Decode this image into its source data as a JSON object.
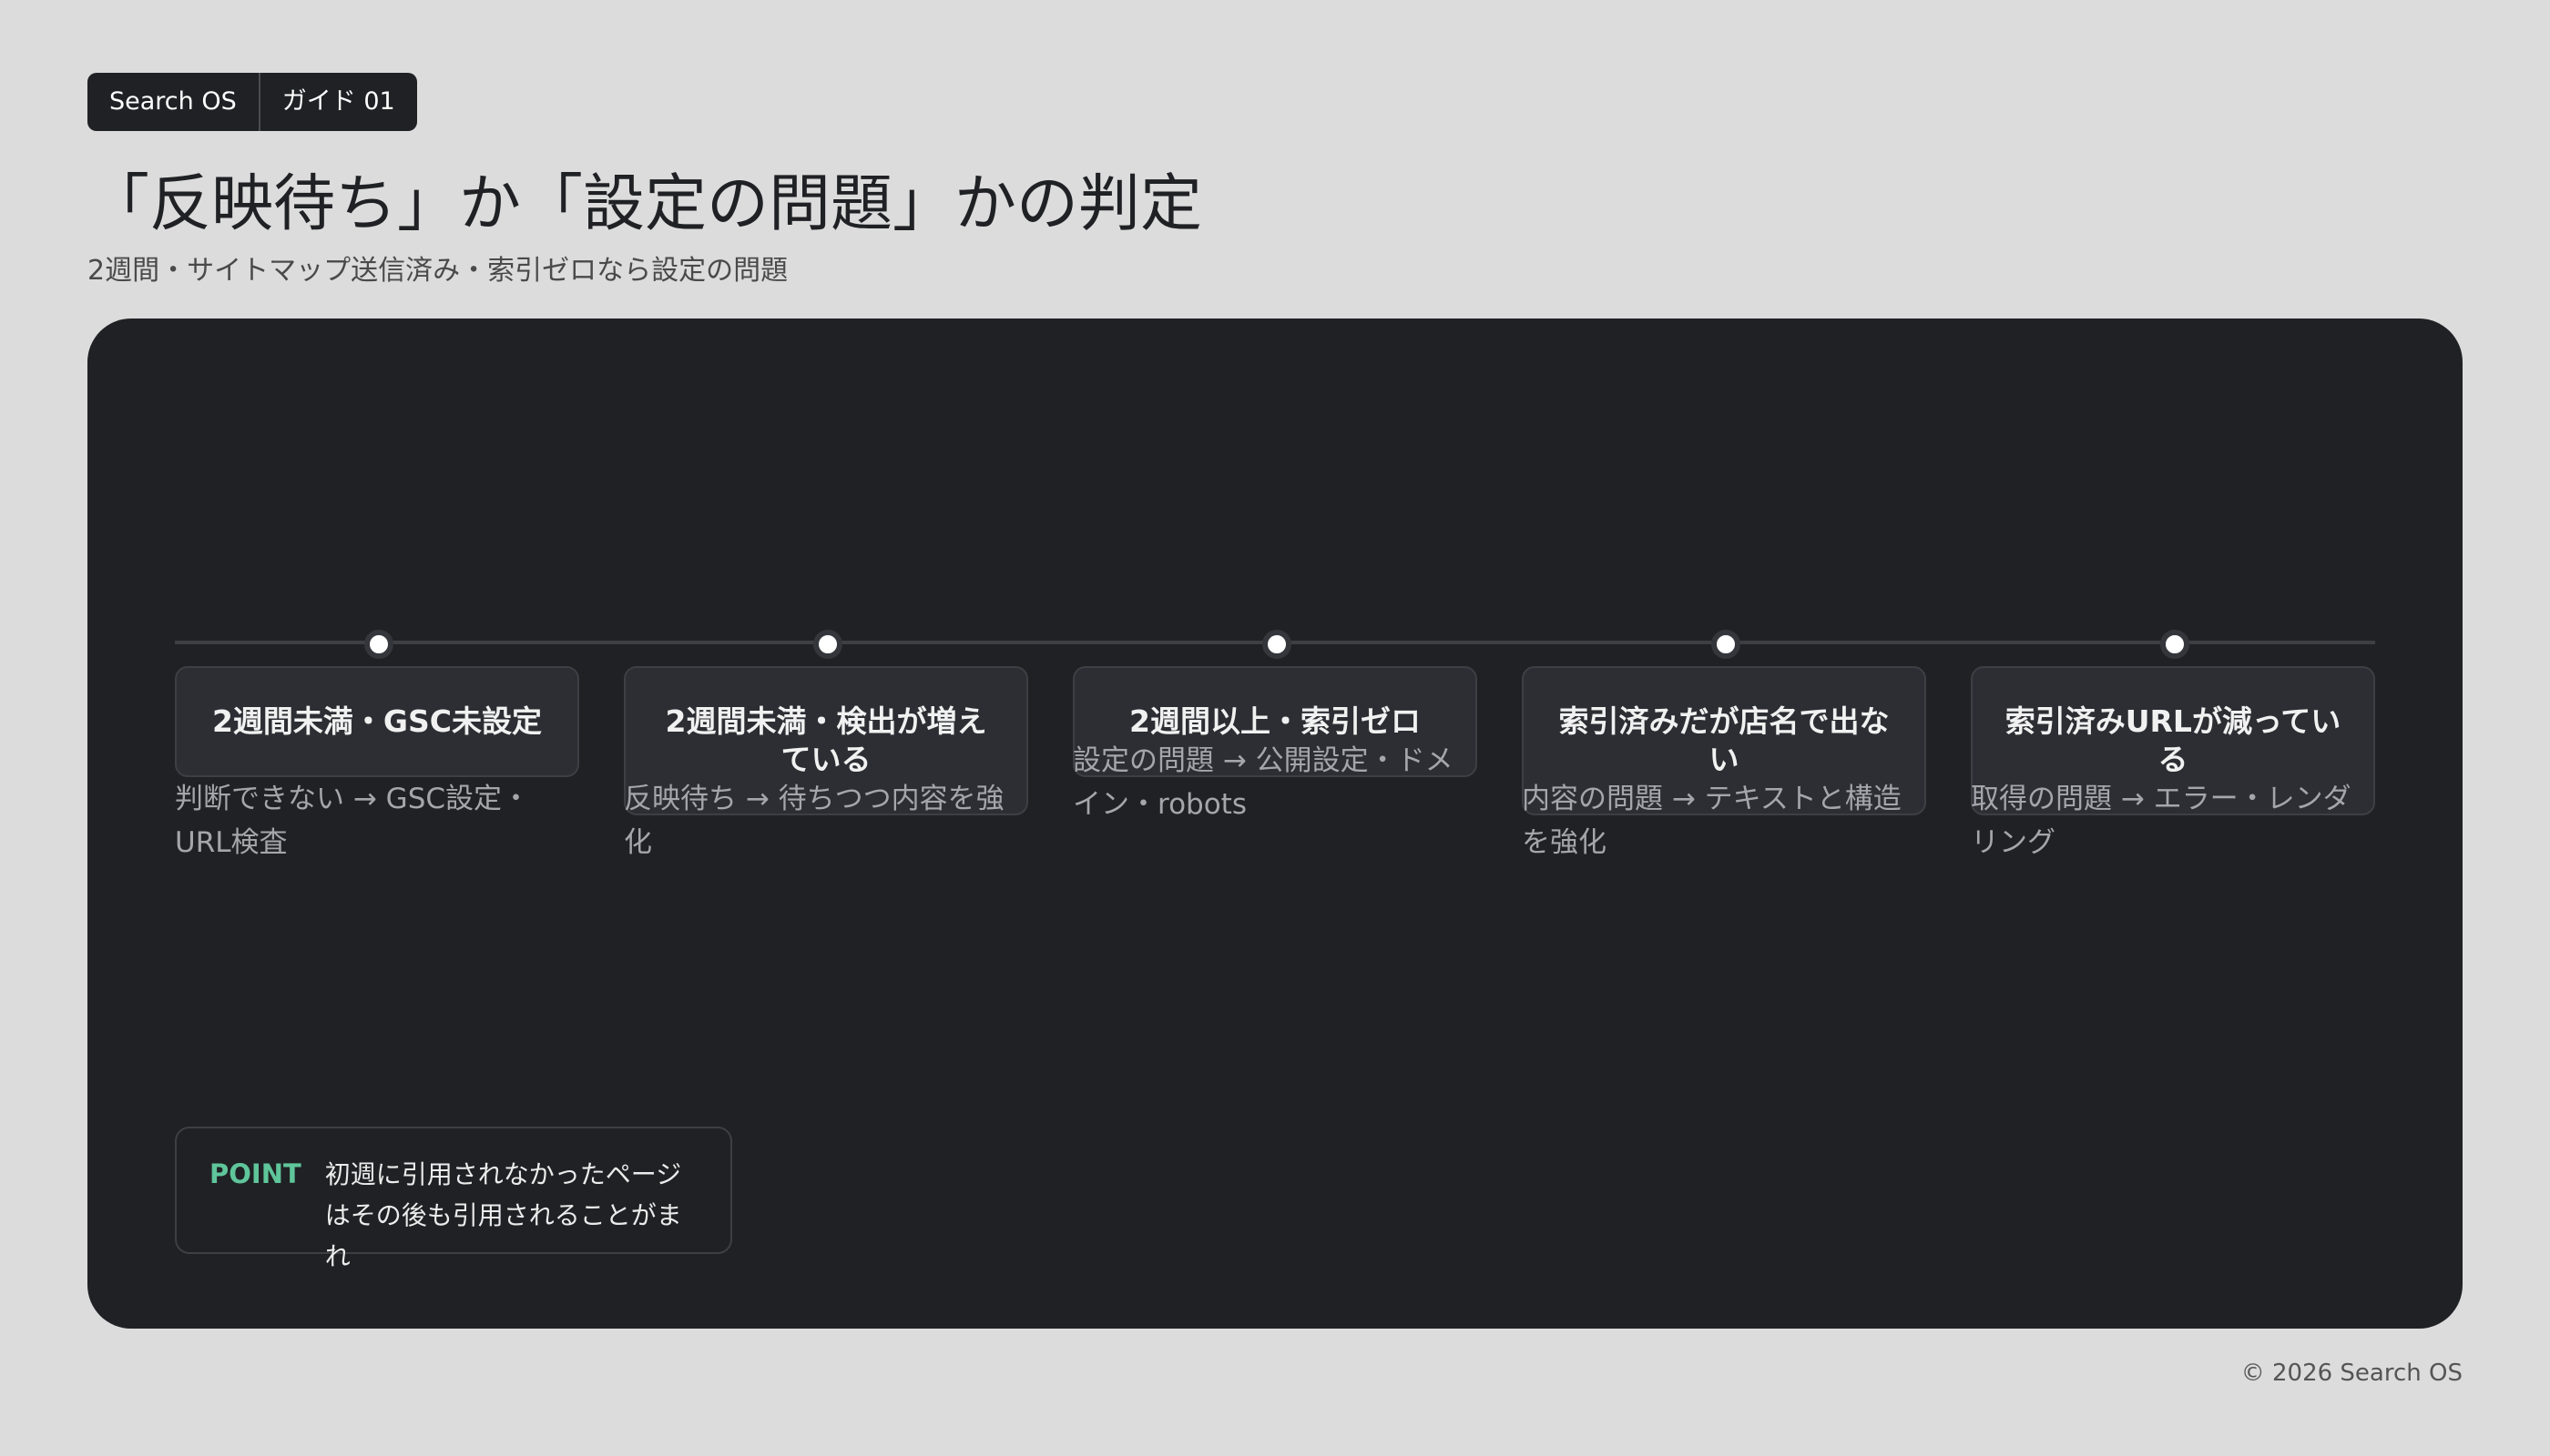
{
  "badge": {
    "brand": "Search OS",
    "guide": "ガイド 01"
  },
  "header": {
    "title": "「反映待ち」か「設定の問題」かの判定",
    "subtitle": "2週間・サイトマップ送信済み・索引ゼロなら設定の問題"
  },
  "timeline": {
    "steps": [
      {
        "title": "2週間未満・GSC未設定",
        "desc": "判断できない → GSC設定・URL検査"
      },
      {
        "title": "2週間未満・検出が増えている",
        "desc": "反映待ち → 待ちつつ内容を強化"
      },
      {
        "title": "2週間以上・索引ゼロ",
        "desc": "設定の問題 → 公開設定・ドメイン・robots"
      },
      {
        "title": "索引済みだが店名で出ない",
        "desc": "内容の問題 → テキストと構造を強化"
      },
      {
        "title": "索引済みURLが減っている",
        "desc": "取得の問題 → エラー・レンダリング"
      }
    ]
  },
  "point": {
    "label": "POINT",
    "text": "初週に引用されなかったページはその後も引用されることがまれ"
  },
  "footer": {
    "copyright": "© 2026 Search OS"
  },
  "colors": {
    "background": "#dcdcdc",
    "panel": "#202124",
    "card": "#2c2e33",
    "accent": "#5fc59a"
  }
}
